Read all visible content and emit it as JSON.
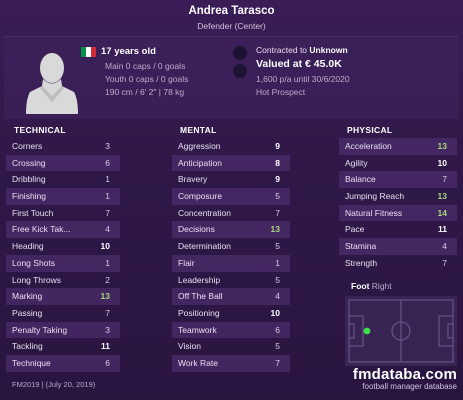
{
  "player": {
    "name": "Andrea Tarasco",
    "position": "Defender (Center)",
    "age_label": "17 years old",
    "main_caps": "Main 0 caps / 0 goals",
    "youth_caps": "Youth 0 caps / 0 goals",
    "physique": "190 cm / 6' 2\" | 78 kg",
    "nation_flag_colors": [
      "#009246",
      "#ffffff",
      "#ce2b37"
    ]
  },
  "contract": {
    "contracted_prefix": "Contracted to",
    "club": "Unknown",
    "valued": "Valued at € 45.0K",
    "wage_line": "1,600 p/a until 30/6/2020",
    "status": "Hot Prospect"
  },
  "technical": {
    "title": "TECHNICAL",
    "rows": [
      {
        "label": "Corners",
        "value": "3"
      },
      {
        "label": "Crossing",
        "value": "6"
      },
      {
        "label": "Dribbling",
        "value": "1"
      },
      {
        "label": "Finishing",
        "value": "1"
      },
      {
        "label": "First Touch",
        "value": "7"
      },
      {
        "label": "Free Kick Tak...",
        "value": "4"
      },
      {
        "label": "Heading",
        "value": "10"
      },
      {
        "label": "Long Shots",
        "value": "1"
      },
      {
        "label": "Long Throws",
        "value": "2"
      },
      {
        "label": "Marking",
        "value": "13"
      },
      {
        "label": "Passing",
        "value": "7"
      },
      {
        "label": "Penalty Taking",
        "value": "3"
      },
      {
        "label": "Tackling",
        "value": "11"
      },
      {
        "label": "Technique",
        "value": "6"
      }
    ]
  },
  "mental": {
    "title": "MENTAL",
    "rows": [
      {
        "label": "Aggression",
        "value": "9"
      },
      {
        "label": "Anticipation",
        "value": "8"
      },
      {
        "label": "Bravery",
        "value": "9"
      },
      {
        "label": "Composure",
        "value": "5"
      },
      {
        "label": "Concentration",
        "value": "7"
      },
      {
        "label": "Decisions",
        "value": "13"
      },
      {
        "label": "Determination",
        "value": "5"
      },
      {
        "label": "Flair",
        "value": "1"
      },
      {
        "label": "Leadership",
        "value": "5"
      },
      {
        "label": "Off The Ball",
        "value": "4"
      },
      {
        "label": "Positioning",
        "value": "10"
      },
      {
        "label": "Teamwork",
        "value": "6"
      },
      {
        "label": "Vision",
        "value": "5"
      },
      {
        "label": "Work Rate",
        "value": "7"
      }
    ]
  },
  "physical": {
    "title": "PHYSICAL",
    "rows": [
      {
        "label": "Acceleration",
        "value": "13"
      },
      {
        "label": "Agility",
        "value": "10"
      },
      {
        "label": "Balance",
        "value": "7"
      },
      {
        "label": "Jumping Reach",
        "value": "13"
      },
      {
        "label": "Natural Fitness",
        "value": "14"
      },
      {
        "label": "Pace",
        "value": "11"
      },
      {
        "label": "Stamina",
        "value": "4"
      },
      {
        "label": "Strength",
        "value": "7"
      }
    ]
  },
  "foot": {
    "label": "Foot",
    "side": "Right"
  },
  "footer": {
    "version": "FM2019 | (July 20, 2019)",
    "brand": "fmdataba.com",
    "tagline": "football manager database"
  },
  "colors": {
    "background": "#2b1642",
    "accent_value": "#a8d97d",
    "pitch_lines": "#6f5a92",
    "position_dot": "#3ee04a"
  }
}
